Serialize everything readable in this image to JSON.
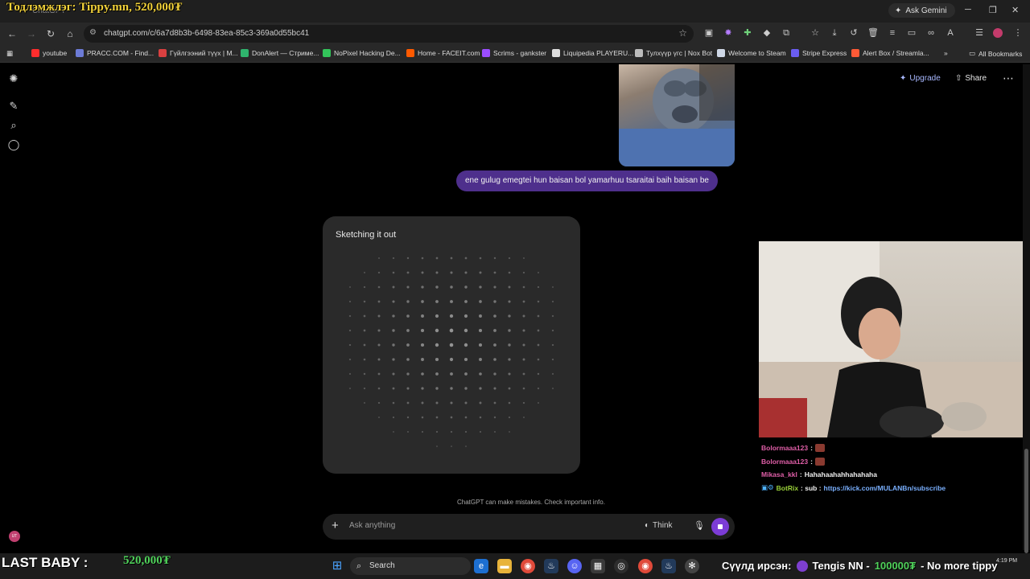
{
  "stream_overlay": {
    "top_banner_label": "Тодлэмжлэг: Tippy.mn,",
    "top_banner_amount": "520,000₮",
    "bottom_label": "LAST BABY :",
    "bottom_amount": "520,000₮",
    "ticker_label": "Сүүлд ирсэн:",
    "ticker_name": "Tengis NN -",
    "ticker_amount": "100000₮",
    "ticker_message": "- No more tippy"
  },
  "browser": {
    "ask_gemini": "Ask Gemini",
    "url": "chatgpt.com/c/6a7d8b3b-6498-83ea-85c3-369a0d55bc41",
    "bookmarks": [
      {
        "label": "youtube",
        "color": "#ff2d2d"
      },
      {
        "label": "PRACC.COM - Find...",
        "color": "#6c7bd6"
      },
      {
        "label": "Гүйлгээний түүх | M...",
        "color": "#d94040"
      },
      {
        "label": "DonAlert — Стриме...",
        "color": "#2fb46d"
      },
      {
        "label": "NoPixel Hacking De...",
        "color": "#33c45a"
      },
      {
        "label": "Home - FACEIT.com",
        "color": "#ff5a00"
      },
      {
        "label": "Scrims - gankster",
        "color": "#9b4dff"
      },
      {
        "label": "Liquipedia PLAYERU...",
        "color": "#dddddd"
      },
      {
        "label": "Тулхүүр үгс | Nox Bot",
        "color": "#bbbbbb"
      },
      {
        "label": "Welcome to Steam",
        "color": "#cfd8e6"
      },
      {
        "label": "Stripe Express",
        "color": "#6a5df2"
      },
      {
        "label": "Alert Box / Streamla...",
        "color": "#ff5a36"
      }
    ],
    "all_bookmarks": "All Bookmarks"
  },
  "chatgpt": {
    "upgrade": "Upgrade",
    "share": "Share",
    "user_message": "ene gulug emegtei hun baisan bol yamarhuu tsaraitai baih baisan be",
    "sketch_title": "Sketching it out",
    "disclaimer": "ChatGPT can make mistakes. Check important info.",
    "composer_placeholder": "Ask anything",
    "think_label": "Think",
    "avatar_initials": "UT"
  },
  "stream_chat": [
    {
      "user": "Bolormaaa123",
      "sep": ":",
      "text": "",
      "emote": true,
      "user_color": "pink"
    },
    {
      "user": "Bolormaaa123",
      "sep": ":",
      "text": "",
      "emote": true,
      "user_color": "pink"
    },
    {
      "user": "Mikasa_kkl",
      "sep": ":",
      "text": "Hahahaahahhahahaha",
      "emote": false,
      "user_color": "pink"
    },
    {
      "user": "BotRix",
      "sep": ": sub :",
      "text": "https://kick.com/MULANBn/subscribe",
      "emote": false,
      "user_color": "green"
    }
  ],
  "taskbar": {
    "search_label": "Search",
    "time": "4:19 PM"
  }
}
